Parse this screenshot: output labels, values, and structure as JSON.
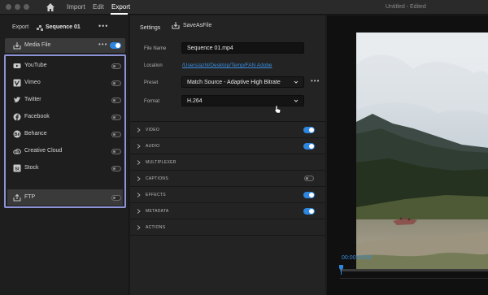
{
  "app": {
    "nav_tabs": [
      {
        "label": "Import",
        "active": false
      },
      {
        "label": "Edit",
        "active": false
      },
      {
        "label": "Export",
        "active": true
      }
    ],
    "document_title": "Untitled - Edited"
  },
  "left_panel": {
    "export_label": "Export",
    "sequence_name": "Sequence 01",
    "media_file": {
      "label": "Media File",
      "enabled": true,
      "icon": "export-file-icon"
    },
    "destinations": [
      {
        "label": "YouTube",
        "icon": "youtube-icon",
        "enabled": false
      },
      {
        "label": "Vimeo",
        "icon": "vimeo-icon",
        "enabled": false
      },
      {
        "label": "Twitter",
        "icon": "twitter-icon",
        "enabled": false
      },
      {
        "label": "Facebook",
        "icon": "facebook-icon",
        "enabled": false
      },
      {
        "label": "Behance",
        "icon": "behance-icon",
        "enabled": false
      },
      {
        "label": "Creative Cloud",
        "icon": "creative-cloud-icon",
        "enabled": false
      },
      {
        "label": "Stock",
        "icon": "stock-icon",
        "enabled": false
      },
      {
        "label": "FTP",
        "icon": "ftp-upload-icon",
        "enabled": false,
        "selected": true
      }
    ]
  },
  "settings": {
    "title": "Settings",
    "save_as_file": "SaveAsFile",
    "file_name_label": "File Name",
    "file_name_value": "Sequence 01.mp4",
    "location_label": "Location",
    "location_value": "/Users/azhl/Desktop/Temp/FAN Adobe",
    "preset_label": "Preset",
    "preset_value": "Match Source - Adaptive High Bitrate",
    "format_label": "Format",
    "format_value": "H.264",
    "sections": [
      {
        "label": "VIDEO",
        "toggle": true
      },
      {
        "label": "AUDIO",
        "toggle": true
      },
      {
        "label": "MULTIPLEXER",
        "toggle": null
      },
      {
        "label": "CAPTIONS",
        "toggle": false
      },
      {
        "label": "EFFECTS",
        "toggle": true
      },
      {
        "label": "METADATA",
        "toggle": true
      },
      {
        "label": "ACTIONS",
        "toggle": null
      }
    ]
  },
  "preview": {
    "timecode": "00:00:00:00",
    "playhead_progress": 0.0
  },
  "colors": {
    "accent": "#2e86de",
    "highlight_border": "#8e93d8",
    "link": "#3a8fe0"
  }
}
